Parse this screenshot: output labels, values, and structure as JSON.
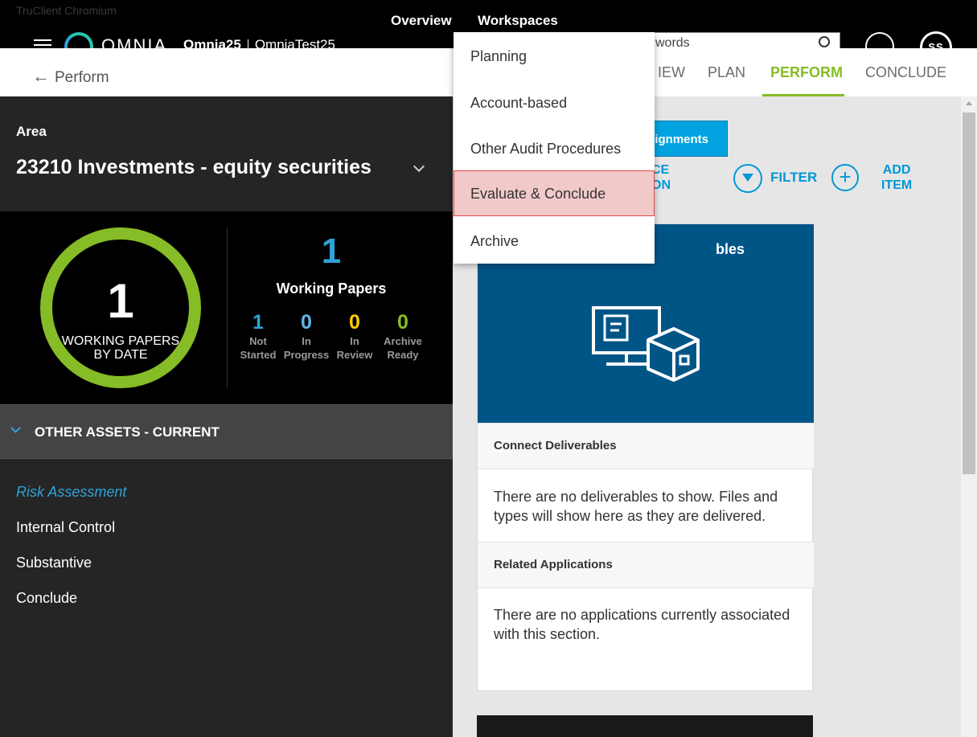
{
  "browser": {
    "title": "TruClient Chromium"
  },
  "topnav": {
    "overview": "Overview",
    "workspaces": "Workspaces"
  },
  "brand": {
    "logo_text": "OMNIA"
  },
  "engagement": {
    "client": "Omnia25",
    "name": "OmniaTest25"
  },
  "search": {
    "placeholder": "words"
  },
  "user": {
    "initials": "SS"
  },
  "header": {
    "back_label": "Perform",
    "tabs": [
      {
        "label": "REVIEW",
        "visible_text": "IEW"
      },
      {
        "label": "PLAN"
      },
      {
        "label": "PERFORM",
        "active": true
      },
      {
        "label": "CONCLUDE"
      }
    ]
  },
  "left": {
    "area_label": "Area",
    "area_name": "23210 Investments - equity securities",
    "ring": {
      "value": "1",
      "label_line1": "WORKING PAPERS",
      "label_line2": "BY DATE",
      "color": "#86bc25"
    },
    "working_papers": {
      "total": "1",
      "title": "Working Papers",
      "stats": [
        {
          "value": "1",
          "line1": "Not",
          "line2": "Started",
          "color": "#2fa3d8"
        },
        {
          "value": "0",
          "line1": "In",
          "line2": "Progress",
          "color": "#62b5e5"
        },
        {
          "value": "0",
          "line1": "In",
          "line2": "Review",
          "color": "#ffcd00"
        },
        {
          "value": "0",
          "line1": "Archive",
          "line2": "Ready",
          "color": "#86bc25"
        }
      ]
    },
    "section_title": "OTHER ASSETS - CURRENT",
    "nav": [
      "Risk Assessment",
      "Internal Control",
      "Substantive",
      "Conclude"
    ]
  },
  "main": {
    "assignments_button": "Assignments",
    "assignments_visible": "signments",
    "evidence_line1": "CE",
    "evidence_line2": "ON",
    "filter_label": "FILTER",
    "add_item_line1": "ADD",
    "add_item_line2": "ITEM",
    "card": {
      "hero_title": "Deliverables",
      "hero_visible": "bles",
      "connect_title": "Connect Deliverables",
      "connect_text": "There are no deliverables to show. Files and types will show here as they are delivered.",
      "related_title": "Related Applications",
      "related_text": "There are no applications currently associated with this section."
    }
  },
  "dropdown": {
    "items": [
      "Planning",
      "Account-based",
      "Other Audit Procedures",
      "Evaluate & Conclude",
      "Archive"
    ],
    "highlighted_index": 3
  },
  "colors": {
    "accent_green": "#86bc25",
    "accent_blue": "#00a3e0",
    "hero_blue": "#005587"
  }
}
